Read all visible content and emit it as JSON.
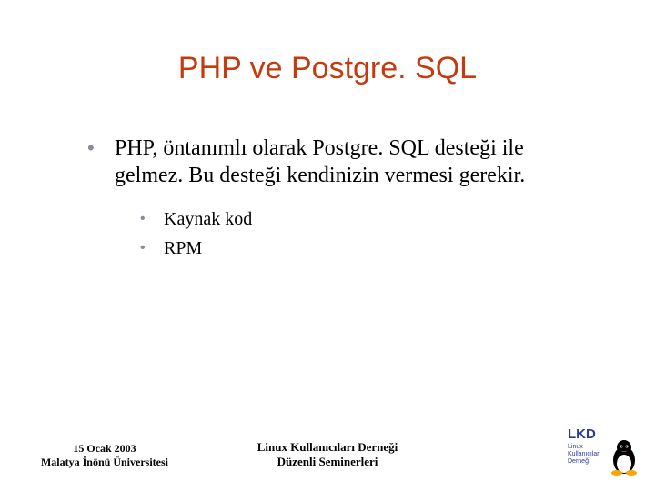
{
  "title": "PHP ve Postgre. SQL",
  "bullets": [
    {
      "text": "PHP, öntanımlı olarak Postgre. SQL desteği ile gelmez. Bu desteği kendinizin vermesi gerekir.",
      "children": [
        {
          "text": "Kaynak kod"
        },
        {
          "text": "RPM"
        }
      ]
    }
  ],
  "footer": {
    "left_line1": "15 Ocak 2003",
    "left_line2": "Malatya İnönü Üniversitesi",
    "center_line1": "Linux Kullanıcıları Derneği",
    "center_line2": "Düzenli Seminerleri",
    "logo_text_top": "LKD",
    "logo_text_sub1": "Linux",
    "logo_text_sub2": "Kullanıcıları",
    "logo_text_sub3": "Derneği"
  }
}
